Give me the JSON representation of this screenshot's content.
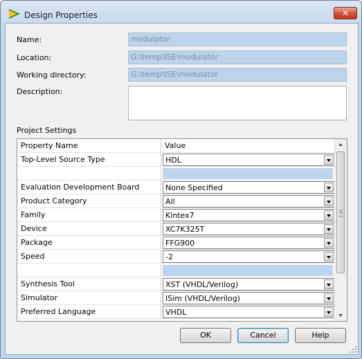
{
  "window": {
    "title": "Design Properties",
    "close_glyph": "✕"
  },
  "fields": {
    "name": {
      "label": "Name:",
      "value": "modulator"
    },
    "location": {
      "label": "Location:",
      "value": "G:\\temp\\ISE\\modulator"
    },
    "working_directory": {
      "label": "Working directory:",
      "value": "G:\\temp\\ISE\\modulator"
    },
    "description": {
      "label": "Description:",
      "value": ""
    }
  },
  "project_settings": {
    "label": "Project Settings",
    "headers": {
      "name": "Property Name",
      "value": "Value"
    },
    "rows": [
      {
        "name": "Top-Level Source Type",
        "value": "HDL"
      },
      {
        "name": "",
        "value": ""
      },
      {
        "name": "Evaluation Development Board",
        "value": "None Specified"
      },
      {
        "name": "Product Category",
        "value": "All"
      },
      {
        "name": "Family",
        "value": "Kintex7"
      },
      {
        "name": "Device",
        "value": "XC7K325T"
      },
      {
        "name": "Package",
        "value": "FFG900"
      },
      {
        "name": "Speed",
        "value": "-2"
      },
      {
        "name": "",
        "value": ""
      },
      {
        "name": "Synthesis Tool",
        "value": "XST (VHDL/Verilog)"
      },
      {
        "name": "Simulator",
        "value": "ISim (VHDL/Verilog)"
      },
      {
        "name": "Preferred Language",
        "value": "VHDL"
      }
    ]
  },
  "buttons": {
    "ok": "OK",
    "cancel": "Cancel",
    "help": "Help"
  }
}
